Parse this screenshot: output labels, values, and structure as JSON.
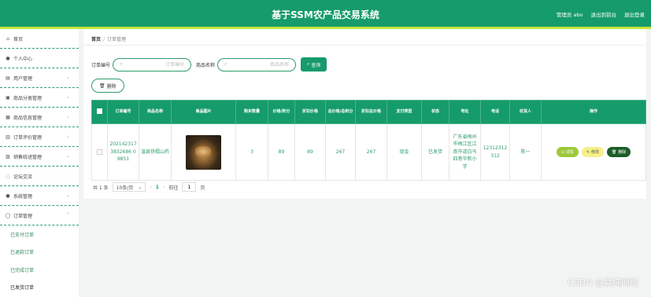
{
  "header": {
    "title": "基于SSM农产品交易系统",
    "admin": "管理员 abo",
    "exit_to_front": "退出到前台",
    "logout": "退出登录"
  },
  "colors": {
    "primary": "#169b6b",
    "accent_strip": "#c4e63a",
    "btn_detail": "#9ec83a",
    "btn_edit": "#f6f08a",
    "btn_delete": "#1c5d26"
  },
  "sidebar": {
    "items": [
      {
        "icon": "home-icon",
        "label": "首页"
      },
      {
        "icon": "user-icon",
        "label": "个人中心"
      },
      {
        "icon": "users-icon",
        "label": "用户管理"
      },
      {
        "icon": "category-icon",
        "label": "商品分类管理"
      },
      {
        "icon": "goods-icon",
        "label": "商品信息管理"
      },
      {
        "icon": "chart-icon",
        "label": "订单评价管理"
      },
      {
        "icon": "stats-icon",
        "label": "销售统计管理"
      },
      {
        "icon": "forum-icon",
        "label": "论坛交流"
      },
      {
        "icon": "settings-icon",
        "label": "系统管理"
      },
      {
        "icon": "order-icon",
        "label": "订单管理"
      }
    ],
    "sub_items": [
      "已支付订单",
      "已退款订单",
      "已完成订单",
      "已发货订单"
    ]
  },
  "breadcrumb": {
    "home": "首页",
    "separator": "/",
    "current": "订单管理"
  },
  "search": {
    "order_label": "订单编号",
    "order_placeholder": "订单编号",
    "product_label": "商品名称",
    "product_placeholder": "商品名称",
    "button": "查询"
  },
  "batch_delete": "删除",
  "table": {
    "headers": [
      "订单编号",
      "商品名称",
      "商品图片",
      "购买数量",
      "价格/积分",
      "折扣价格",
      "总价格/总积分",
      "折扣总价格",
      "支付类型",
      "状态",
      "地址",
      "电话",
      "收货人",
      "操作"
    ],
    "rows": [
      {
        "order_no": "2021423173832686 09851",
        "product_name": "温县铁棍山药",
        "qty": "3",
        "price": "89",
        "discount_price": "89",
        "total": "267",
        "discount_total": "267",
        "pay_type": "现金",
        "status": "已发货",
        "address": "广东省梅州市梅江区江南市道白马四巷华新小学",
        "phone": "12312312312",
        "receiver": "陈一",
        "actions": {
          "detail": "详情",
          "edit": "修改",
          "delete": "删除"
        }
      }
    ]
  },
  "pagination": {
    "total": "共 1 条",
    "page_size": "10条/页",
    "prev": "‹",
    "current_page": "1",
    "next": "›",
    "goto_label": "前往",
    "goto_value": "1",
    "page_suffix": "页"
  },
  "watermark": "CSDN @真纯网络"
}
